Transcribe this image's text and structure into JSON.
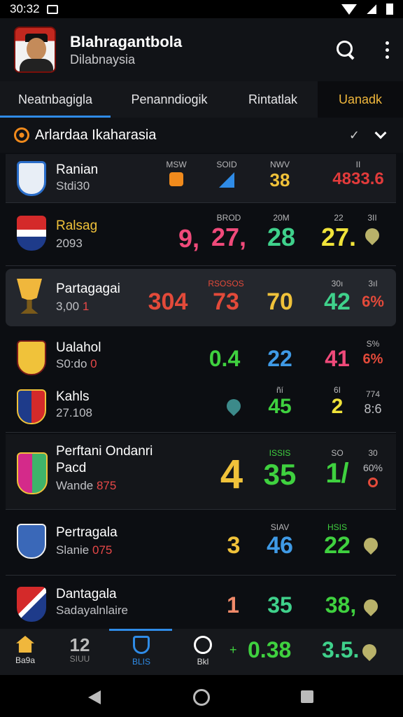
{
  "status": {
    "time": "30:32"
  },
  "header": {
    "title": "Blahragantbola",
    "subtitle": "Dilabnaysia"
  },
  "tabs": [
    "Neatnbagigla",
    "Penanndiogik",
    "Rintatlak",
    "Uanadk"
  ],
  "section": {
    "title": "Arlardaa Ikaharasia"
  },
  "colors": {
    "accent": "#2f8be6",
    "gold": "#f0b73c",
    "row_highlight": "#24272d"
  },
  "rows": [
    {
      "name": "Ranian",
      "sub": "Stdi30",
      "l1": "MSW",
      "l2": "SOID",
      "l3": "NWV",
      "l4": "II",
      "v3": "38",
      "v4": "4833.6"
    },
    {
      "name": "Ralsag",
      "sub": "2093",
      "l2": "BROD",
      "l3": "20M",
      "l4": "22",
      "l5": "3II",
      "v1": "9,",
      "v2": "27,",
      "v3": "28",
      "v4": "27."
    },
    {
      "name": "Partagagai",
      "sub": "3,00",
      "sub_red": "1",
      "l2": "RSOSOS",
      "l4": "30ı",
      "l5": "3ıI",
      "v1": "304",
      "v2": "73",
      "v3": "70",
      "v4": "42",
      "v5": "6%"
    },
    {
      "name": "Ualahol",
      "sub": "S0:do",
      "sub_red": "0",
      "l5": "S%",
      "v1": "0.4",
      "v2": "22",
      "v3": "41",
      "v5": "6%"
    },
    {
      "name": "Kahls",
      "sub": "27.108",
      "l3": "ñí",
      "l4": "6I",
      "l5": "774",
      "v3": "45",
      "v4": "2",
      "v5": "8:6"
    },
    {
      "name": "Perftani Ondanri",
      "name2": "Pacd",
      "sub": "Wande",
      "sub_red": "875",
      "l3": "ISSIS",
      "l4": "SO",
      "l5": "30",
      "v2": "4",
      "v3": "35",
      "v4": "1/",
      "v5": "60%"
    },
    {
      "name": "Pertragala",
      "sub": "Slanie",
      "sub_red": "075",
      "l3": "SIAV",
      "l4": "HSIS",
      "v2": "3",
      "v3": "46",
      "v4": "22"
    },
    {
      "name": "Dantagala",
      "sub": "Sadayalnlaire",
      "v2": "1",
      "v3": "35",
      "v4": "38,"
    }
  ],
  "bottom_nav": {
    "items": [
      {
        "label": "Ba9a",
        "value": ""
      },
      {
        "label": "SIUU",
        "value": "12"
      },
      {
        "label": "BLIS",
        "value": ""
      },
      {
        "label": "Bkl",
        "value": ""
      }
    ],
    "extra": {
      "sign": "+",
      "v1": "0.38",
      "v2": "3.5."
    }
  }
}
